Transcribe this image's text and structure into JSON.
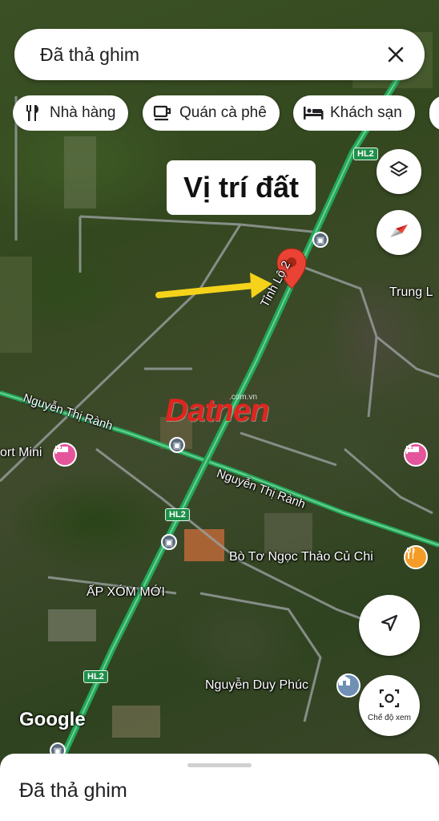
{
  "search": {
    "title": "Đã thả ghim",
    "close_icon": "close-icon"
  },
  "chips": [
    {
      "label": "Nhà hàng",
      "icon": "restaurant-icon"
    },
    {
      "label": "Quán cà phê",
      "icon": "coffee-icon"
    },
    {
      "label": "Khách sạn",
      "icon": "hotel-icon"
    }
  ],
  "annotation": {
    "label": "Vị trí đất"
  },
  "map_labels": {
    "road_main": "Tỉnh Lộ 2",
    "road_nguyen_1": "Nguyễn Thị Rành",
    "road_nguyen_2": "Nguyễn Thị Rành",
    "hamlet": "ẤP XÓM MỚI",
    "poi_left": "ort Mini",
    "poi_right": "Trung L",
    "poi_restaurant": "Bò Tơ Ngọc Thảo Củ Chi",
    "poi_school": "Nguyễn Duy Phúc",
    "shield_hl2_top": "HL2",
    "shield_hl2_mid": "HL2",
    "shield_hl2_bottom": "HL2"
  },
  "watermark": {
    "text": "Datnen",
    "sub": ".com.vn"
  },
  "buttons": {
    "camera_label": "Chế độ xem"
  },
  "branding": {
    "google": "Google"
  },
  "sheet": {
    "title": "Đã thả ghim"
  },
  "colors": {
    "road_green": "#22a65a",
    "pin_red": "#ea4335",
    "arrow_yellow": "#f5d31a",
    "hotel_pink": "#e5559b",
    "restaurant_orange": "#f39c28"
  }
}
